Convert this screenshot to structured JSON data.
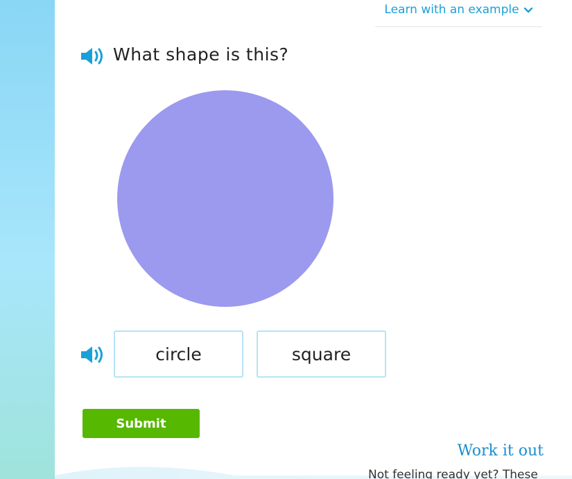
{
  "learn_example": {
    "label": "Learn with an example",
    "icon": "chevron-down-icon"
  },
  "question": {
    "text": "What shape is this?",
    "audio_icon": "speaker-icon"
  },
  "shape": {
    "kind": "circle",
    "fill": "#9b9aee"
  },
  "answers": {
    "audio_icon": "speaker-icon",
    "options": [
      {
        "label": "circle"
      },
      {
        "label": "square"
      }
    ]
  },
  "submit": {
    "label": "Submit",
    "color": "#56b800"
  },
  "footer": {
    "work_it_out": "Work it out",
    "not_ready": "Not feeling ready yet? These"
  },
  "colors": {
    "accent": "#1aa0d8",
    "rail": "#89d6f5",
    "choice_border": "#b6e3f3"
  }
}
